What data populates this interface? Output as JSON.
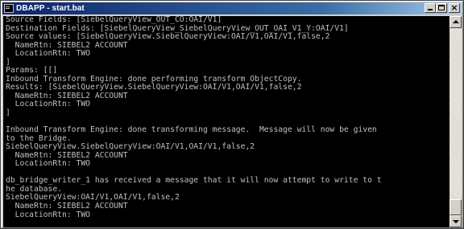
{
  "window": {
    "title": "DBAPP - start.bat",
    "buttons": {
      "minimize": "minimize",
      "maximize": "maximize",
      "close": "×"
    }
  },
  "console": {
    "lines": [
      "Source Fields: [SiebelQueryView_OUT_CO:OAI/V1]",
      "Destination Fields: [SiebelQueryView_SiebelQueryView_OUT_OAI_V1_Y:OAI/V1]",
      "Source values: [SiebelQueryView.SiebelQueryView:OAI/V1,OAI/V1,false,2",
      "  NameRtn: SIEBEL2 ACCOUNT",
      "  LocationRtn: TWO",
      "]",
      "Params: [[]",
      "Inbound Transform Engine: done performing transform ObjectCopy.",
      "Results: [SiebelQueryView.SiebelQueryView:OAI/V1,OAI/V1,false,2",
      "  NameRtn: SIEBEL2 ACCOUNT",
      "  LocationRtn: TWO",
      "]",
      "",
      "Inbound Transform Engine: done transforming message.  Message will now be given",
      "to the Bridge.",
      "SiebelQueryView.SiebelQueryView:OAI/V1,OAI/V1,false,2",
      "  NameRtn: SIEBEL2 ACCOUNT",
      "  LocationRtn: TWO",
      "",
      "db_bridge_writer_1 has received a message that it will now attempt to write to t",
      "he database.",
      "SiebelQueryView:OAI/V1,OAI/V1,false,2",
      "  NameRtn: SIEBEL2 ACCOUNT",
      "  LocationRtn: TWO",
      ""
    ]
  },
  "colors": {
    "title_bar": "#0a246a",
    "console_background": "#000000",
    "console_text": "#c0c0c0"
  }
}
